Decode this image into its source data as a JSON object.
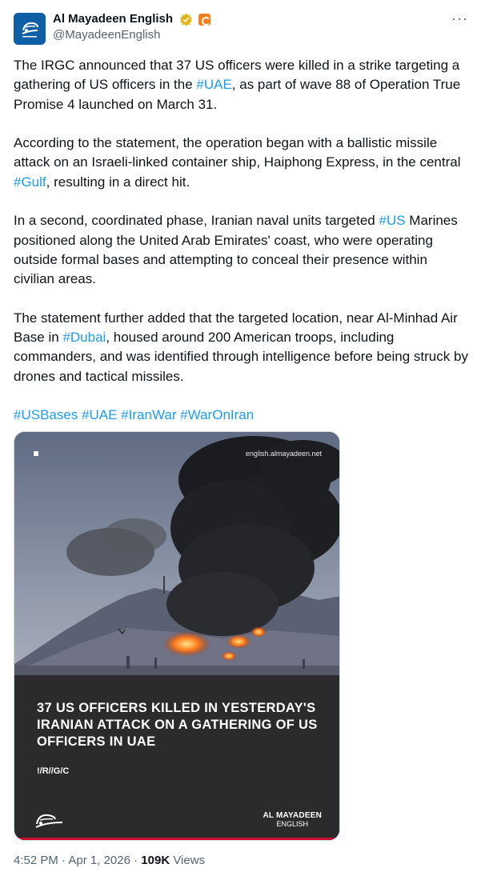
{
  "author": {
    "display_name": "Al Mayadeen English",
    "handle": "@MayadeenEnglish",
    "verified_icon": "verified-gold-badge-icon",
    "affiliate_icon": "affiliate-badge-icon"
  },
  "more_label": "···",
  "body": {
    "p1": {
      "a": "The IRGC announced that 37 US officers were killed in a strike targeting a gathering of US officers in the ",
      "tag": "#UAE",
      "b": ", as part of wave 88 of Operation True Promise 4 launched on March 31."
    },
    "p2": {
      "a": "According to the statement, the operation began with a ballistic missile attack on an Israeli-linked container ship, Haiphong Express, in the central ",
      "tag": "#Gulf",
      "b": ", resulting in a direct hit."
    },
    "p3": {
      "a": "In a second, coordinated phase, Iranian naval units targeted ",
      "tag": "#US",
      "b": " Marines positioned along the United Arab Emirates' coast, who were operating outside formal bases and attempting to conceal their presence within civilian areas."
    },
    "p4": {
      "a": "The statement further added that the targeted location, near Al-Minhad Air Base in ",
      "tag": "#Dubai",
      "b": ", housed around 200 American troops, including commanders, and was identified through intelligence before being struck by drones and tactical missiles."
    },
    "hashtags": [
      "#USBases",
      "#UAE",
      "#IranWar",
      "#WarOnIran"
    ]
  },
  "media": {
    "url_overlay": "english.almayadeen.net",
    "headline": "37 US OFFICERS KILLED IN YESTERDAY'S IRANIAN ATTACK ON A GATHERING OF US OFFICERS IN UAE",
    "source": "!/R//G/C",
    "brand_line1": "AL MAYADEEN",
    "brand_line2": "ENGLISH"
  },
  "footer": {
    "time": "4:52 PM",
    "sep1": " · ",
    "date": "Apr 1, 2026",
    "sep2": " · ",
    "views_count": "109K",
    "views_label": " Views"
  },
  "colors": {
    "link": "#1d9bf0",
    "muted": "#536471",
    "text": "#0f1419",
    "brand_red": "#c8102e"
  }
}
